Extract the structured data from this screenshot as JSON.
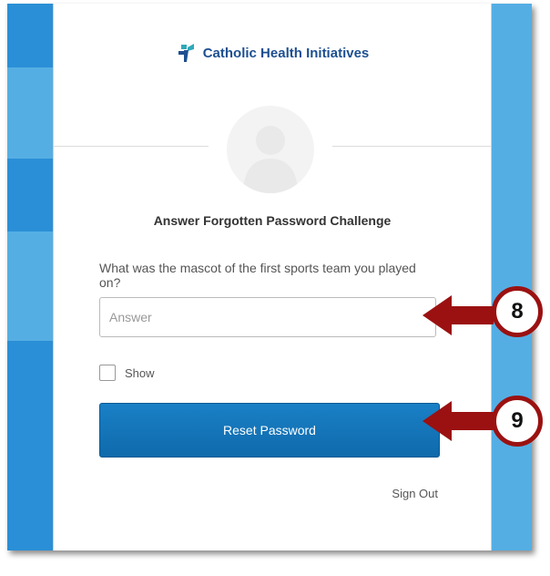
{
  "brand": {
    "name": "Catholic Health Initiatives"
  },
  "form": {
    "title": "Answer Forgotten Password Challenge",
    "question": "What was the mascot of the first sports team you played on?",
    "answer_placeholder": "Answer",
    "show_label": "Show",
    "reset_button": "Reset Password",
    "sign_out": "Sign Out"
  },
  "annotations": [
    {
      "number": "8"
    },
    {
      "number": "9"
    }
  ],
  "colors": {
    "background": "#2a8fd6",
    "brand_text": "#1d4f91",
    "primary_button": "#1a80c6",
    "callout": "#9b1111"
  }
}
